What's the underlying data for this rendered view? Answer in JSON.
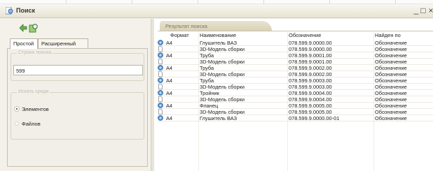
{
  "window": {
    "title": "Поиск",
    "minimize_label": "_",
    "maximize_label": "□",
    "close_label": "×"
  },
  "left": {
    "tabs": [
      {
        "label": "Простой"
      },
      {
        "label": "Расширенный"
      }
    ],
    "search_group_label": "Строка поиска",
    "search_value": "599",
    "scope_group_label": "Искать среди",
    "radios": [
      {
        "label": "Элементов",
        "checked": true
      },
      {
        "label": "Файлов",
        "checked": false
      }
    ]
  },
  "results": {
    "tab_label": "Результат поиска",
    "columns": [
      "Формат",
      "Наименование",
      "Обозначение",
      "Найден по"
    ],
    "rows": [
      {
        "icon": "part-icon",
        "format": "А4",
        "name": "Глушитель ВАЗ",
        "designation": "078.599.9.0000.00",
        "found_by": "Обозначение"
      },
      {
        "icon": "document-icon",
        "format": "",
        "name": "3D-Модель сборки",
        "designation": "078.599.9.0000.00",
        "found_by": "Обозначение"
      },
      {
        "icon": "part-icon",
        "format": "А4",
        "name": "Труба",
        "designation": "078.599.9.0001.00",
        "found_by": "Обозначение"
      },
      {
        "icon": "document-icon",
        "format": "",
        "name": "3D-Модель сборки",
        "designation": "078.599.9.0001.00",
        "found_by": "Обозначение"
      },
      {
        "icon": "part-icon",
        "format": "А4",
        "name": "Труба",
        "designation": "078.599.9.0002.00",
        "found_by": "Обозначение"
      },
      {
        "icon": "document-icon",
        "format": "",
        "name": "3D-Модель сборки",
        "designation": "078.599.9.0002.00",
        "found_by": "Обозначение"
      },
      {
        "icon": "part-icon",
        "format": "А4",
        "name": "Труба",
        "designation": "078.599.9.0003.00",
        "found_by": "Обозначение"
      },
      {
        "icon": "document-icon",
        "format": "",
        "name": "3D-Модель сборки",
        "designation": "078.599.9.0003.00",
        "found_by": "Обозначение"
      },
      {
        "icon": "part-icon",
        "format": "А4",
        "name": "Тройник",
        "designation": "078.599.9.0004.00",
        "found_by": "Обозначение"
      },
      {
        "icon": "document-icon",
        "format": "",
        "name": "3D-Модель сборки",
        "designation": "078.599.9.0004.00",
        "found_by": "Обозначение"
      },
      {
        "icon": "part-icon",
        "format": "А4",
        "name": "Фланец",
        "designation": "078.599.9.0005.00",
        "found_by": "Обозначение"
      },
      {
        "icon": "document-icon",
        "format": "",
        "name": "3D-Модель сборки",
        "designation": "078.599.9.0005.00",
        "found_by": "Обозначение"
      },
      {
        "icon": "part-icon",
        "format": "А4",
        "name": "Глушитель ВАЗ",
        "designation": "078.599.9.0000.00-01",
        "found_by": "Обозначение"
      }
    ]
  }
}
